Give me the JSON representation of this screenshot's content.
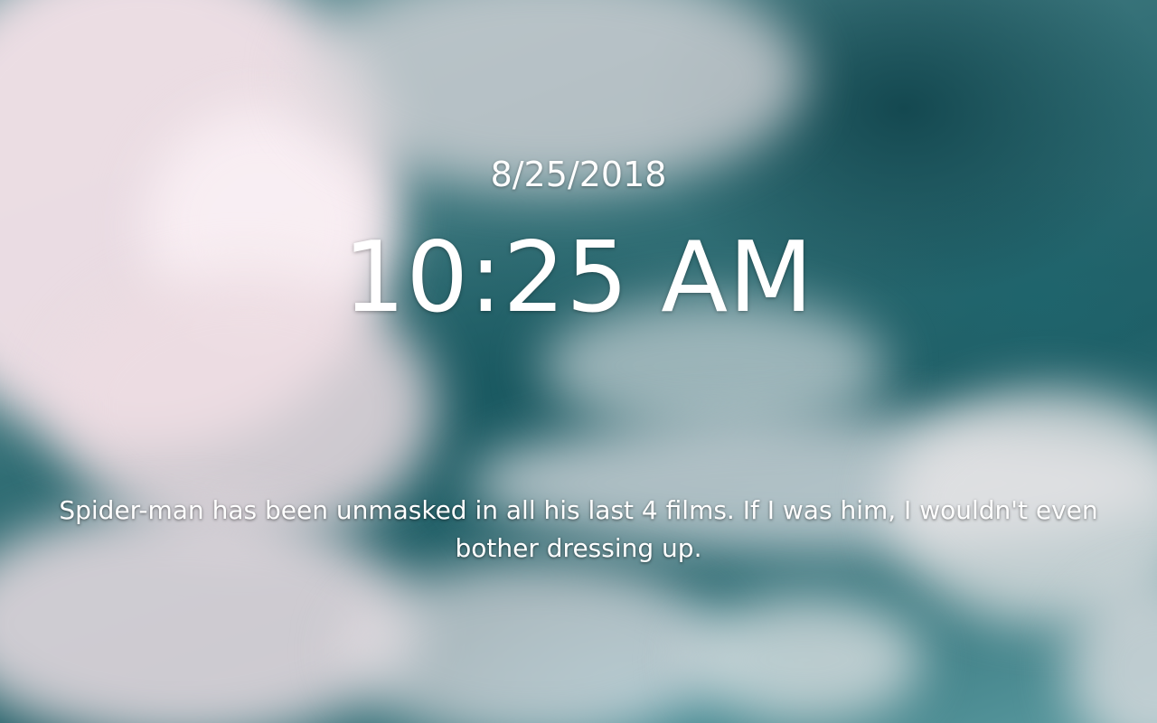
{
  "clock": {
    "date": "8/25/2018",
    "time": "10:25 AM"
  },
  "quote": {
    "text": "Spider-man has been unmasked in all his last 4 films. If I was him, I wouldn't even bother dressing up."
  },
  "background": {
    "sky_color": "#2d6b72",
    "cloud_color": "#f1e4e9"
  }
}
